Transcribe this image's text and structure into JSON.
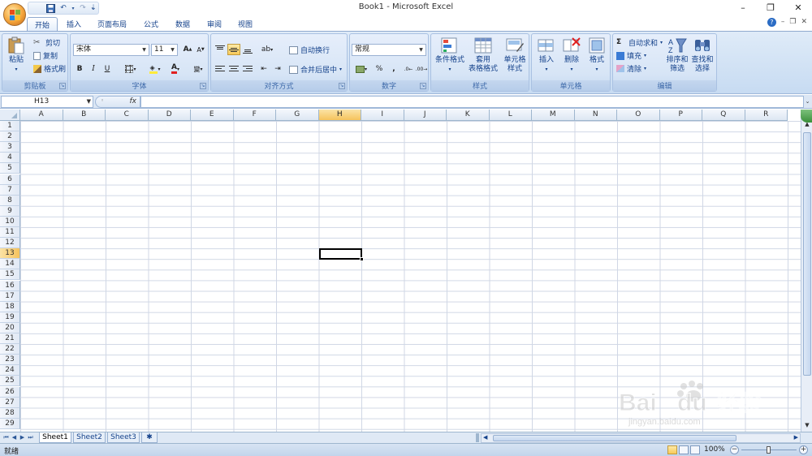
{
  "titlebar": {
    "title": "Book1 - Microsoft Excel",
    "qat_customize": "⇣",
    "undo": "↶",
    "redo": "↷",
    "minimize": "–",
    "restore": "❐",
    "close": "✕"
  },
  "tabs": [
    {
      "label": "开始",
      "active": true
    },
    {
      "label": "插入",
      "active": false
    },
    {
      "label": "页面布局",
      "active": false
    },
    {
      "label": "公式",
      "active": false
    },
    {
      "label": "数据",
      "active": false
    },
    {
      "label": "审阅",
      "active": false
    },
    {
      "label": "视图",
      "active": false
    }
  ],
  "ribbon": {
    "clipboard": {
      "title": "剪贴板",
      "paste": "粘贴",
      "cut": "剪切",
      "copy": "复制",
      "format_painter": "格式刷"
    },
    "font": {
      "title": "字体",
      "font_name": "宋体",
      "font_size": "11",
      "bold": "B",
      "italic": "I",
      "underline": "U",
      "grow": "A",
      "shrink": "A",
      "font_color_letter": "A",
      "phonetic": "變"
    },
    "alignment": {
      "title": "对齐方式",
      "wrap_text": "自动换行",
      "merge_center": "合并后居中"
    },
    "number": {
      "title": "数字",
      "format": "常规",
      "percent": "%",
      "comma": ","
    },
    "styles": {
      "title": "样式",
      "conditional": "条件格式",
      "format_table_1": "套用",
      "format_table_2": "表格格式",
      "cell_styles_1": "单元格",
      "cell_styles_2": "样式"
    },
    "cells": {
      "title": "单元格",
      "insert": "插入",
      "delete": "删除",
      "format": "格式"
    },
    "editing": {
      "title": "编辑",
      "autosum": "自动求和",
      "fill": "填充",
      "clear": "清除",
      "sort_1": "排序和",
      "sort_2": "筛选",
      "find_1": "查找和",
      "find_2": "选择",
      "sigma": "Σ"
    }
  },
  "formula_bar": {
    "name_box": "H13",
    "fx": "fx",
    "value": ""
  },
  "grid": {
    "columns": [
      "A",
      "B",
      "C",
      "D",
      "E",
      "F",
      "G",
      "H",
      "I",
      "J",
      "K",
      "L",
      "M",
      "N",
      "O",
      "P",
      "Q",
      "R"
    ],
    "rows": [
      "1",
      "2",
      "3",
      "4",
      "5",
      "6",
      "7",
      "8",
      "9",
      "10",
      "11",
      "12",
      "13",
      "14",
      "15",
      "16",
      "17",
      "18",
      "19",
      "20",
      "21",
      "22",
      "23",
      "24",
      "25",
      "26",
      "27",
      "28",
      "29"
    ],
    "selected_column": "H",
    "selected_row": "13"
  },
  "sheets": [
    {
      "label": "Sheet1",
      "active": true
    },
    {
      "label": "Sheet2",
      "active": false
    },
    {
      "label": "Sheet3",
      "active": false
    }
  ],
  "statusbar": {
    "status": "就绪",
    "zoom": "100%"
  },
  "watermark": {
    "brand": "Bai du",
    "cn": "经验",
    "url": "jingyan.baidu.com"
  },
  "colors": {
    "ribbon_bg": "#c7dbf2",
    "accent_selected": "#f6c35c",
    "text_blue": "#15428b"
  }
}
